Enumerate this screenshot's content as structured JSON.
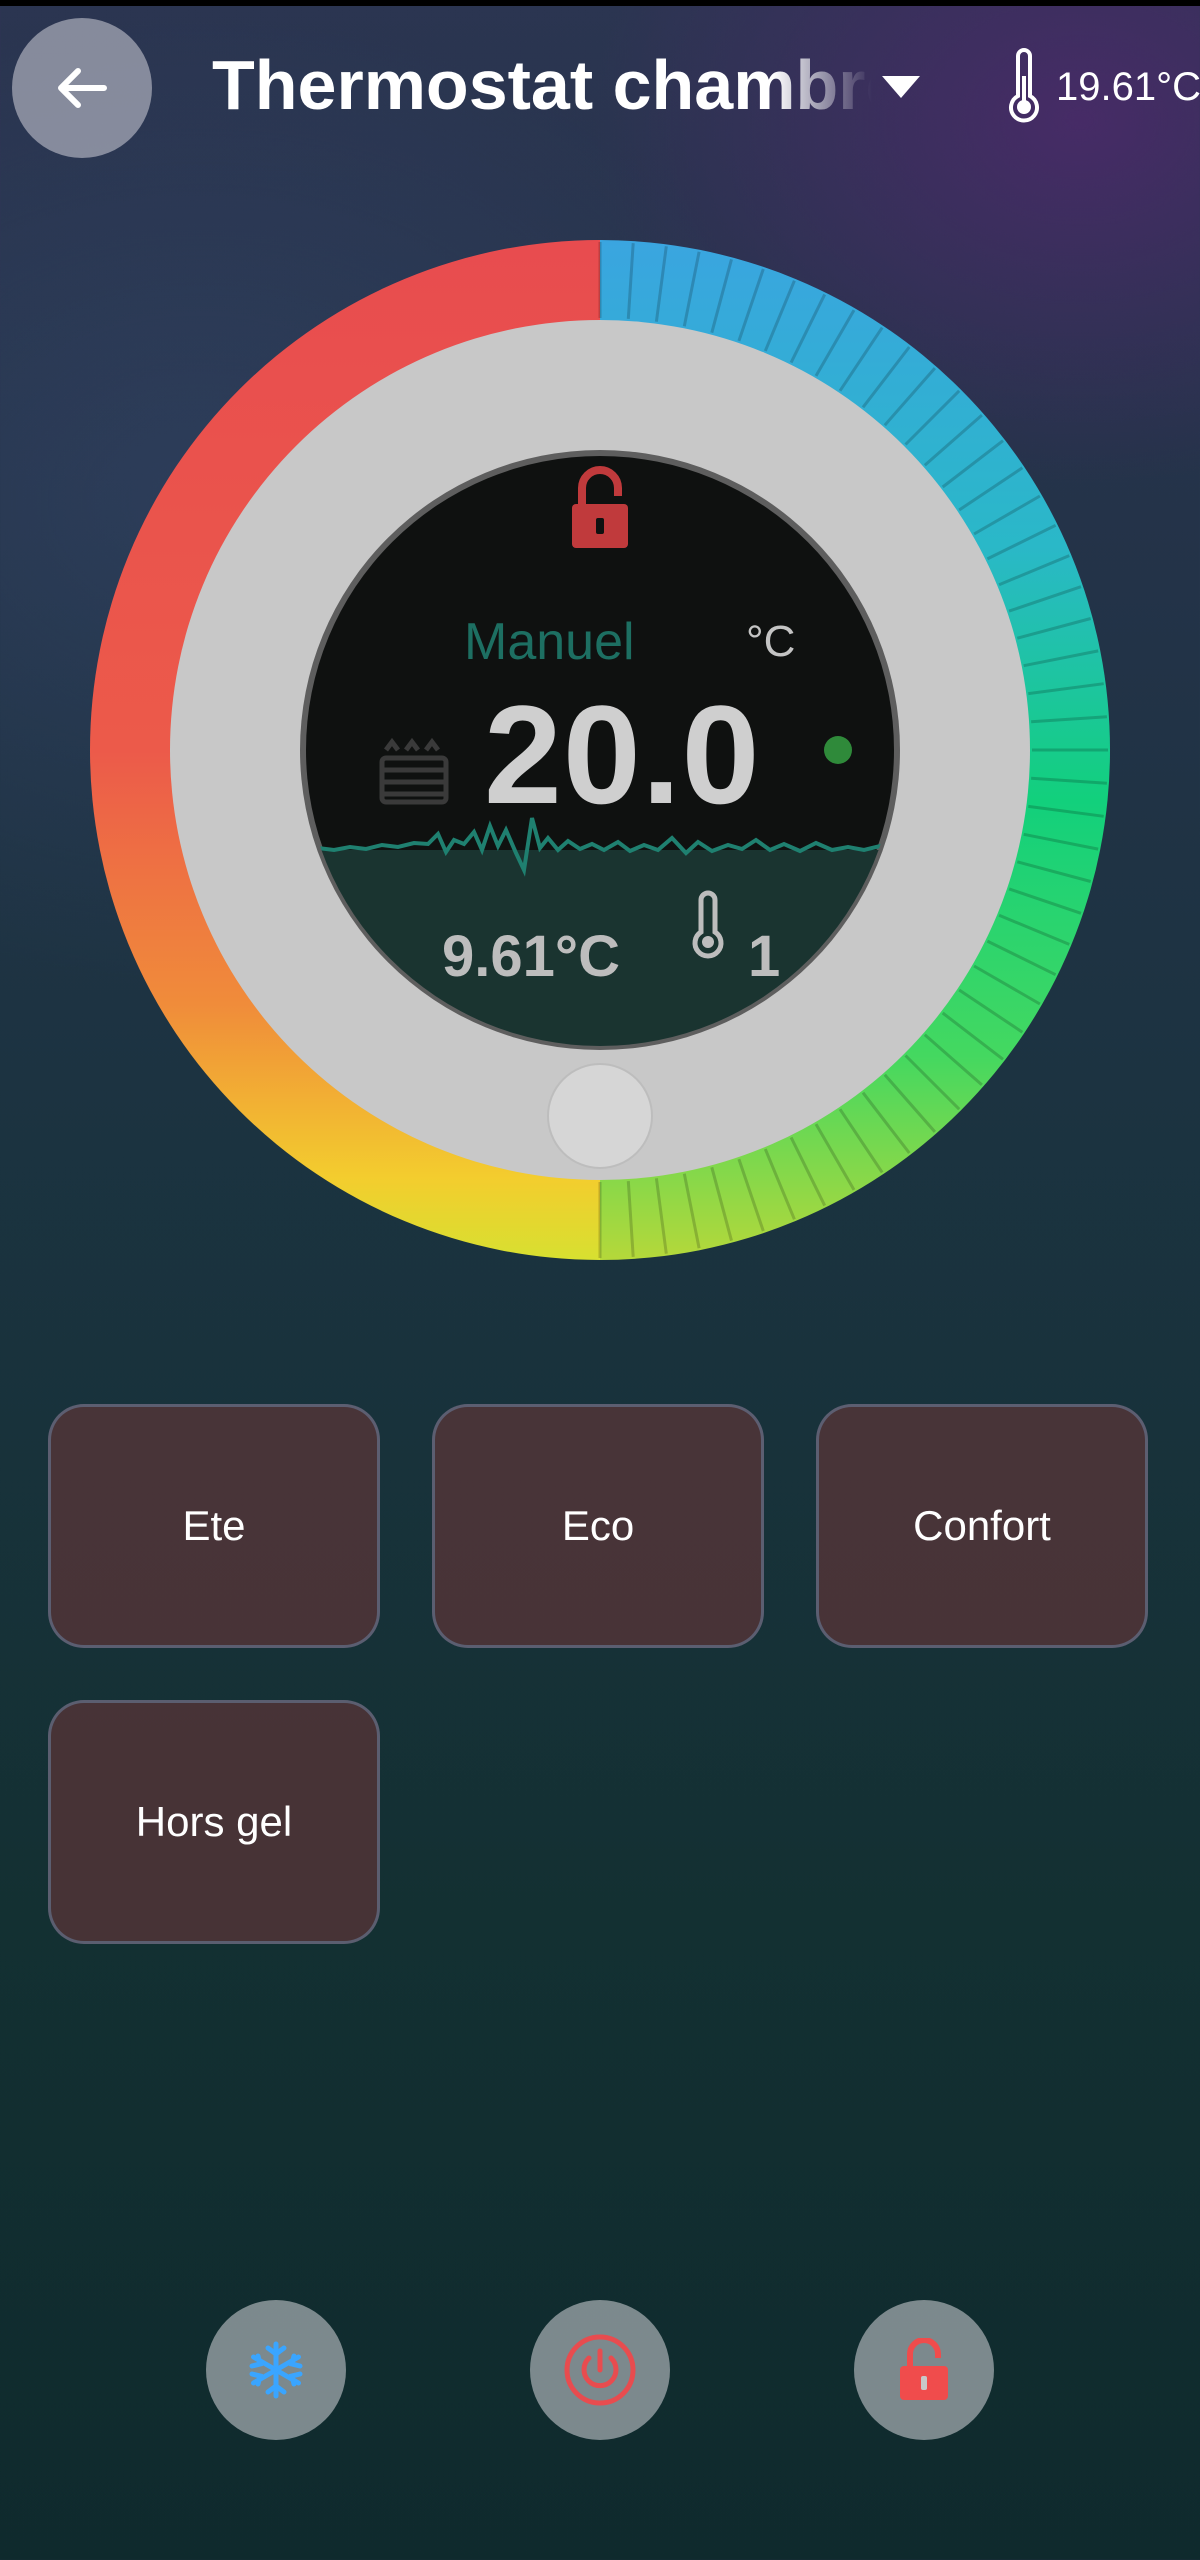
{
  "header": {
    "back_icon": "arrow-left-icon",
    "title": "Thermostat chambre",
    "dropdown_icon": "caret-down-icon",
    "temp_icon": "thermometer-icon",
    "current_temp": "19.61°C"
  },
  "dial": {
    "mode": "Manuel",
    "unit": "°C",
    "setpoint": "20.0",
    "current_temp": "9.61°C",
    "sensor_count": "1",
    "lock_icon": "unlocked-lock-icon",
    "heater_icon": "radiator-icon",
    "status_dot_color": "#2f8a3a",
    "colors": {
      "red": "#e84c4f",
      "orange": "#f08c3a",
      "yellow": "#f3cd2e",
      "green": "#12d07c",
      "cyan": "#2ab8c8",
      "blue": "#3aa5e0"
    }
  },
  "presets": [
    {
      "label": "Ete"
    },
    {
      "label": "Eco"
    },
    {
      "label": "Confort"
    },
    {
      "label": "Hors gel"
    }
  ],
  "actions": [
    {
      "icon": "snowflake-icon",
      "color": "#3aa5ff"
    },
    {
      "icon": "power-icon",
      "color": "#e84c4f"
    },
    {
      "icon": "unlocked-lock-icon",
      "color": "#f04c4c"
    }
  ]
}
